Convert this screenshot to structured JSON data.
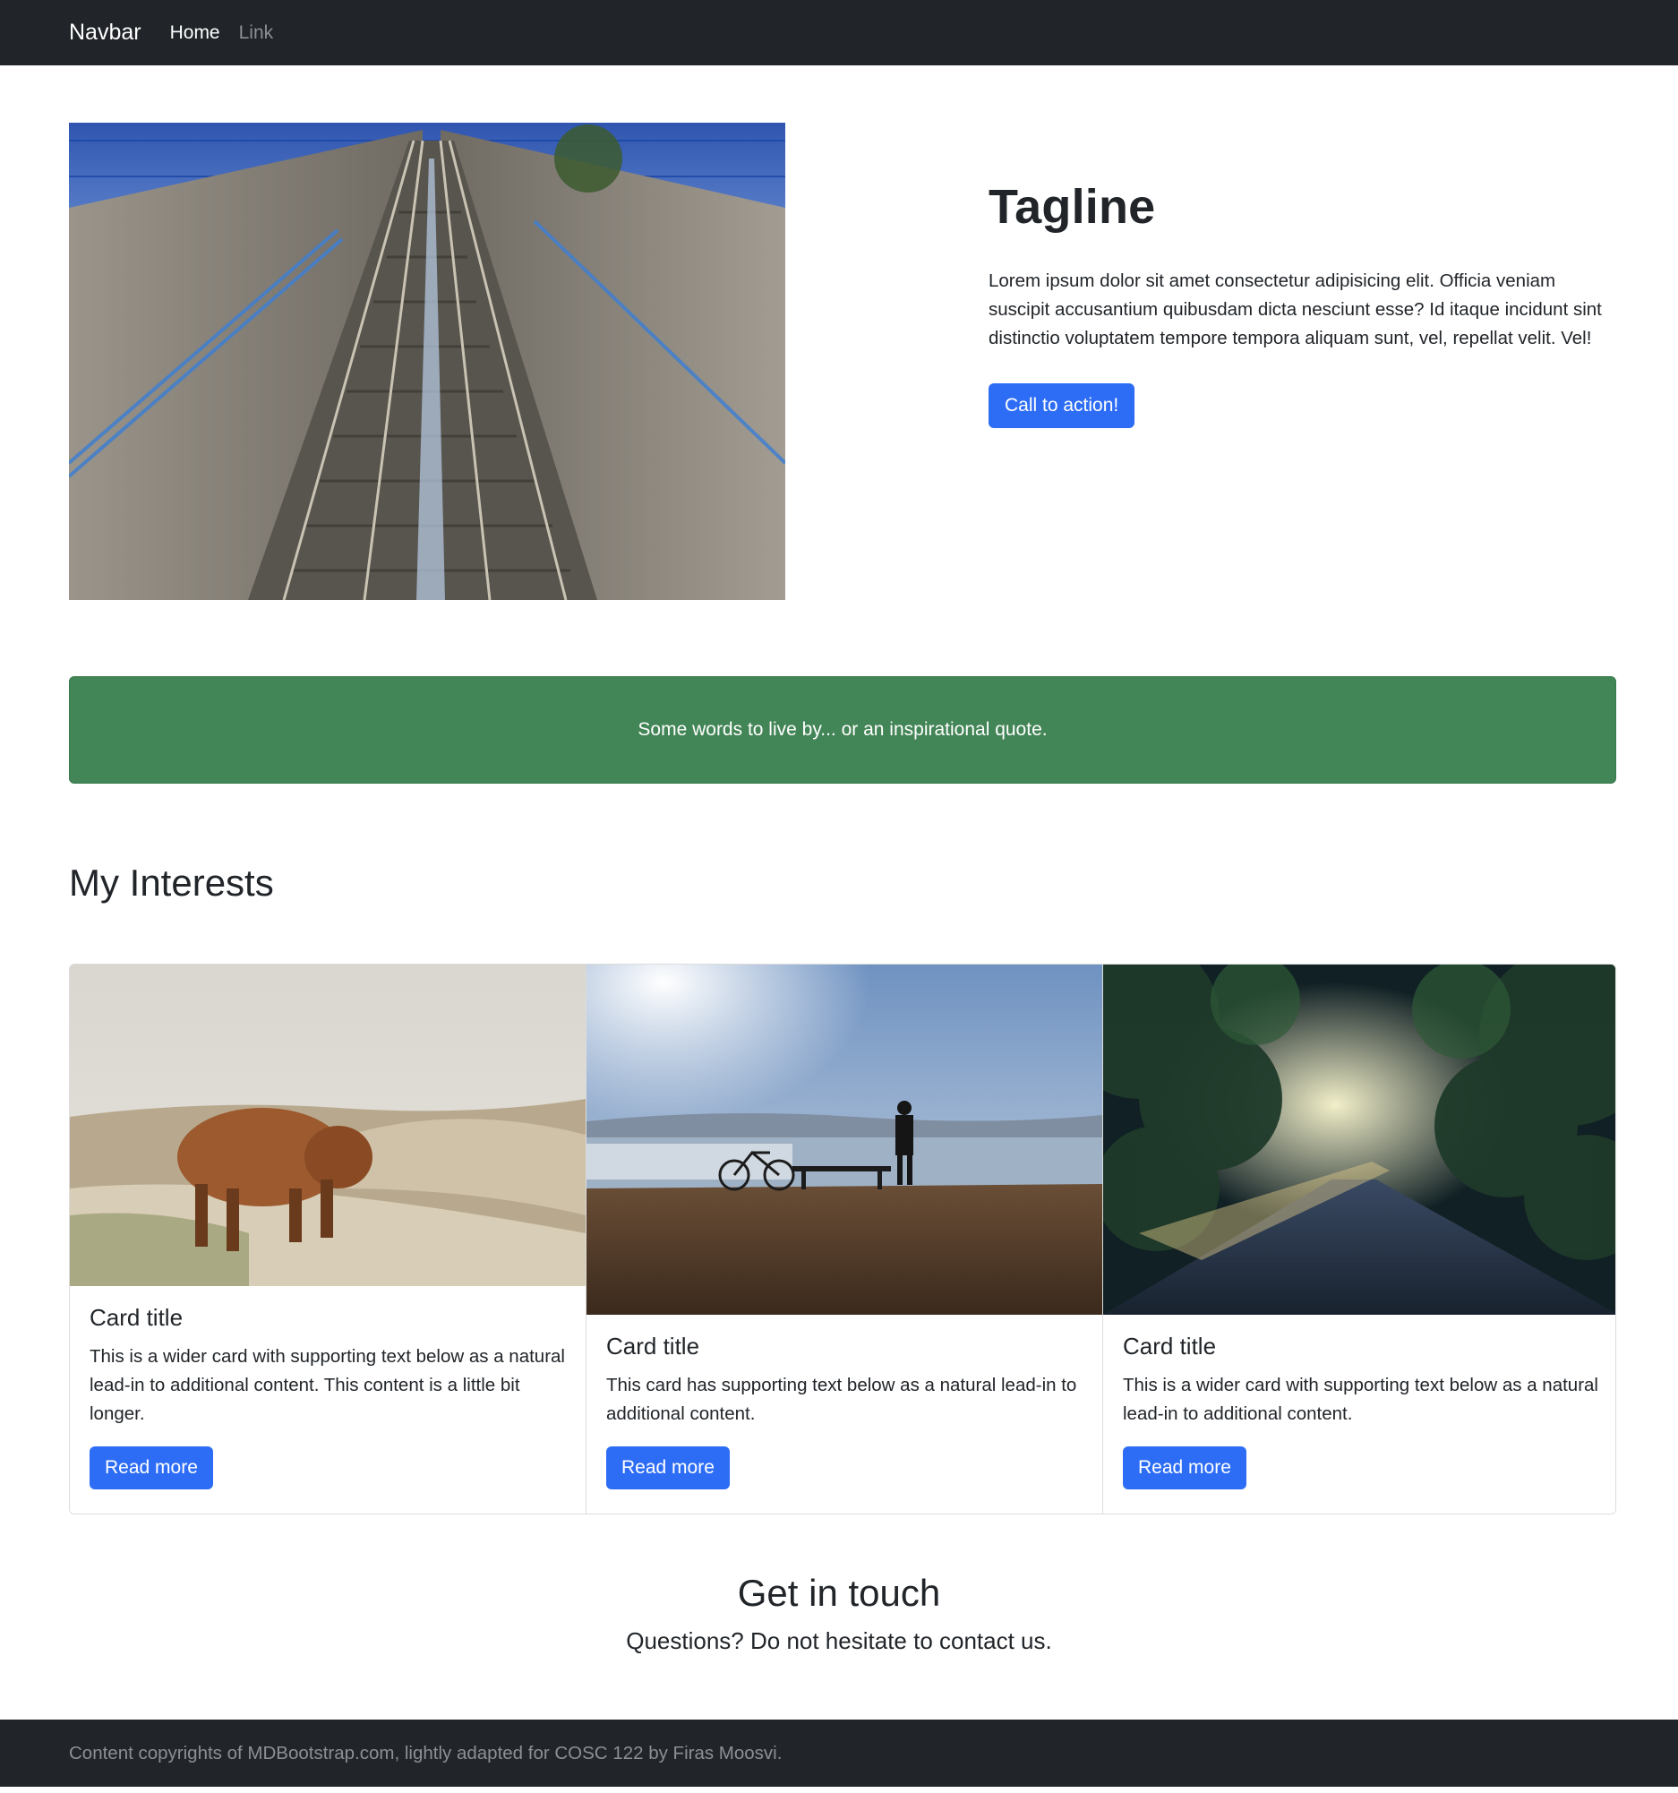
{
  "navbar": {
    "brand": "Navbar",
    "links": [
      {
        "label": "Home",
        "active": true
      },
      {
        "label": "Link",
        "active": false
      }
    ]
  },
  "hero": {
    "image": "railway-tracks-photo",
    "title": "Tagline",
    "text": "Lorem ipsum dolor sit amet consectetur adipisicing elit. Officia veniam suscipit accusantium quibusdam dicta nesciunt esse? Id itaque incidunt sint distinctio voluptatem tempore tempora aliquam sunt, vel, repellat velit. Vel!",
    "cta_label": "Call to action!"
  },
  "quote": {
    "text": "Some words to live by... or an inspirational quote."
  },
  "interests": {
    "title": "My Interests",
    "cards": [
      {
        "image": "highland-cow-photo",
        "title": "Card title",
        "text": "This is a wider card with supporting text below as a natural lead-in to additional content. This content is a little bit longer.",
        "button_label": "Read more"
      },
      {
        "image": "person-bicycle-sea-photo",
        "title": "Card title",
        "text": "This card has supporting text below as a natural lead-in to additional content.",
        "button_label": "Read more"
      },
      {
        "image": "forest-road-photo",
        "title": "Card title",
        "text": "This is a wider card with supporting text below as a natural lead-in to additional content.",
        "button_label": "Read more"
      }
    ]
  },
  "contact": {
    "title": "Get in touch",
    "subtitle": "Questions? Do not hesitate to contact us."
  },
  "footer": {
    "text": "Content copyrights of MDBootstrap.com, lightly adapted for COSC 122 by Firas Moosvi."
  },
  "colors": {
    "navbar_bg": "#212529",
    "primary": "#2d6df6",
    "quote_bg": "#428556"
  }
}
